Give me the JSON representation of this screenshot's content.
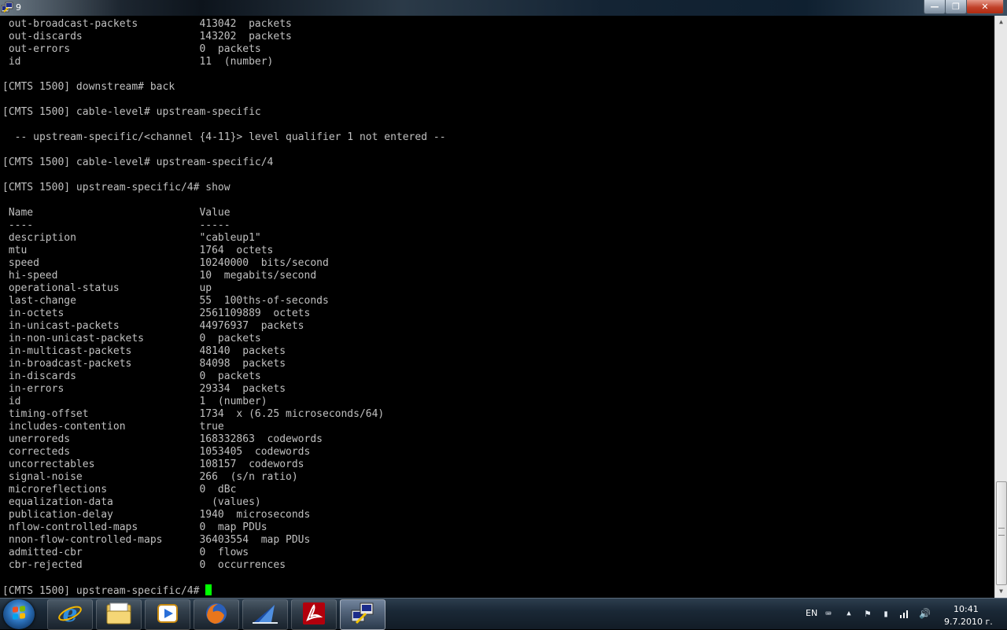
{
  "window": {
    "title": "9",
    "minimize_label": "—",
    "maximize_label": "❐",
    "close_label": "✕"
  },
  "terminal": {
    "lines": [
      " out-broadcast-packets          413042  packets",
      " out-discards                   143202  packets",
      " out-errors                     0  packets",
      " id                             11  (number)",
      "",
      "[CMTS 1500] downstream# back",
      "",
      "[CMTS 1500] cable-level# upstream-specific",
      "",
      "  -- upstream-specific/<channel {4-11}> level qualifier 1 not entered --",
      "",
      "[CMTS 1500] cable-level# upstream-specific/4",
      "",
      "[CMTS 1500] upstream-specific/4# show",
      "",
      " Name                           Value",
      " ----                           -----",
      " description                    \"cableup1\"",
      " mtu                            1764  octets",
      " speed                          10240000  bits/second",
      " hi-speed                       10  megabits/second",
      " operational-status             up",
      " last-change                    55  100ths-of-seconds",
      " in-octets                      2561109889  octets",
      " in-unicast-packets             44976937  packets",
      " in-non-unicast-packets         0  packets",
      " in-multicast-packets           48140  packets",
      " in-broadcast-packets           84098  packets",
      " in-discards                    0  packets",
      " in-errors                      29334  packets",
      " id                             1  (number)",
      " timing-offset                  1734  x (6.25 microseconds/64)",
      " includes-contention            true",
      " unerroreds                     168332863  codewords",
      " correcteds                     1053405  codewords",
      " uncorrectables                 108157  codewords",
      " signal-noise                   266  (s/n ratio)",
      " microreflections               0  dBc",
      " equalization-data                (values)",
      " publication-delay              1940  microseconds",
      " nflow-controlled-maps          0  map PDUs",
      " nnon-flow-controlled-maps      36403554  map PDUs",
      " admitted-cbr                   0  flows",
      " cbr-rejected                   0  occurrences",
      ""
    ],
    "prompt": "[CMTS 1500] upstream-specific/4# "
  },
  "scrollbar": {
    "position_fraction": 0.97
  },
  "taskbar": {
    "items": [
      {
        "name": "internet-explorer",
        "icon": "ie-icon",
        "state": "pinned"
      },
      {
        "name": "windows-explorer",
        "icon": "folder-icon",
        "state": "pinned"
      },
      {
        "name": "media-player",
        "icon": "media-player-icon",
        "state": "pinned"
      },
      {
        "name": "firefox",
        "icon": "firefox-icon",
        "state": "open"
      },
      {
        "name": "app-blue",
        "icon": "sail-icon",
        "state": "open"
      },
      {
        "name": "acrobat",
        "icon": "pdf-icon",
        "state": "open"
      },
      {
        "name": "putty",
        "icon": "putty-icon",
        "state": "active"
      }
    ],
    "tray": {
      "language": "EN",
      "clock_time": "10:41",
      "clock_date": "9.7.2010 г."
    }
  },
  "colors": {
    "terminal_bg": "#000000",
    "terminal_fg": "#c0c0c0",
    "cursor": "#00ff00"
  }
}
